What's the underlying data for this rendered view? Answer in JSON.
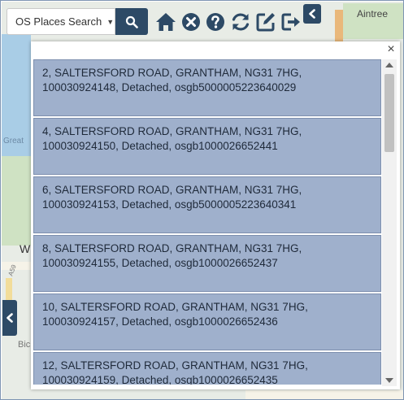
{
  "map": {
    "labels": [
      "Aintree",
      "Great",
      "W",
      "A59",
      "Bic"
    ]
  },
  "toolbar": {
    "search_label": "OS Places Search",
    "icons": [
      "search-icon",
      "home-icon",
      "clear-icon",
      "help-icon",
      "refresh-icon",
      "edit-icon",
      "logout-icon"
    ],
    "accent_color": "#2d4a66"
  },
  "panel": {
    "close_label": "×",
    "results": [
      {
        "line1": "2, SALTERSFORD ROAD, GRANTHAM, NG31 7HG,",
        "line2": "100030924148, Detached, osgb5000005223640029"
      },
      {
        "line1": "4, SALTERSFORD ROAD, GRANTHAM, NG31 7HG,",
        "line2": "100030924150, Detached, osgb1000026652441"
      },
      {
        "line1": "6, SALTERSFORD ROAD, GRANTHAM, NG31 7HG,",
        "line2": "100030924153, Detached, osgb5000005223640341"
      },
      {
        "line1": "8, SALTERSFORD ROAD, GRANTHAM, NG31 7HG,",
        "line2": "100030924155, Detached, osgb1000026652437"
      },
      {
        "line1": "10, SALTERSFORD ROAD, GRANTHAM, NG31 7HG,",
        "line2": "100030924157, Detached, osgb1000026652436"
      },
      {
        "line1": "12, SALTERSFORD ROAD, GRANTHAM, NG31 7HG,",
        "line2": "100030924159, Detached, osgb1000026652435"
      }
    ],
    "result_color": "#9fb0cc"
  }
}
